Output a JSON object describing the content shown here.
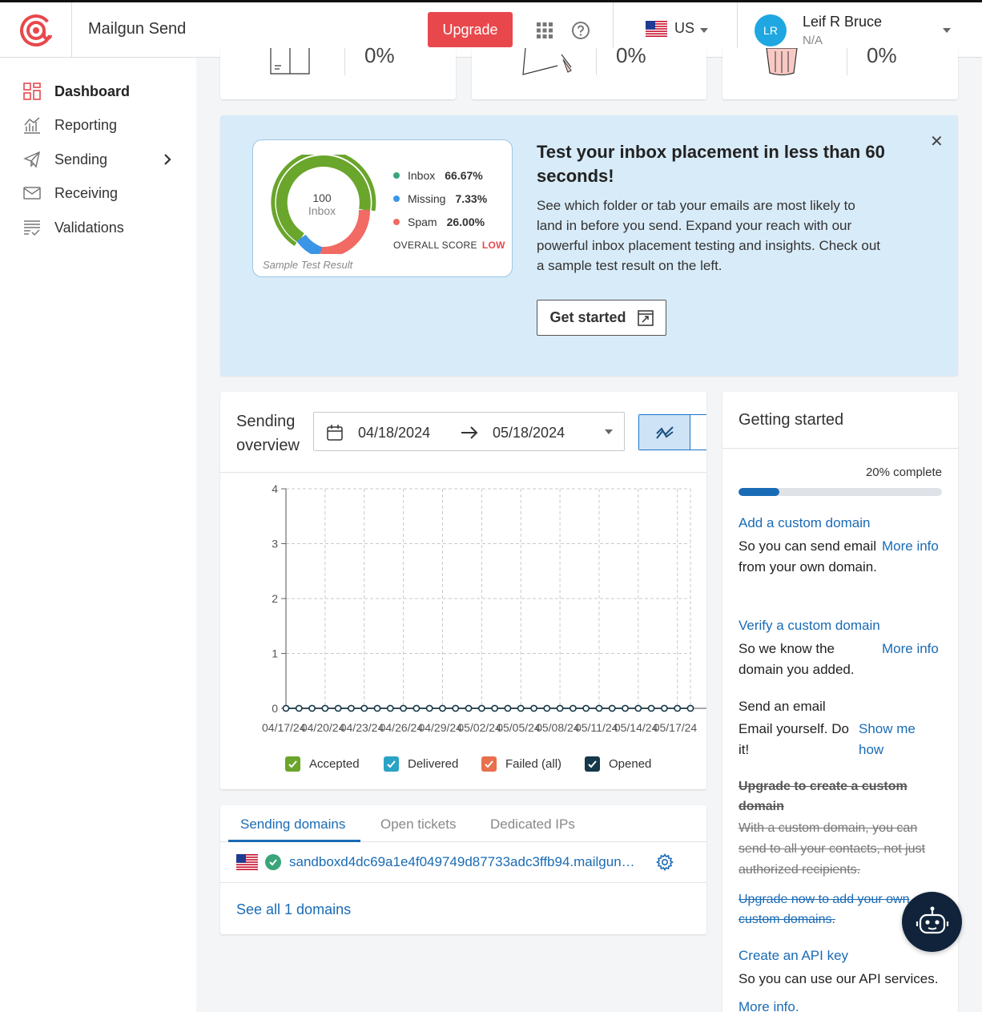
{
  "header": {
    "app_name": "Mailgun Send",
    "upgrade_label": "Upgrade",
    "region": "US",
    "user": {
      "initials": "LR",
      "name": "Leif R Bruce",
      "subtitle": "N/A"
    }
  },
  "sidebar": {
    "items": [
      {
        "label": "Dashboard",
        "icon": "dashboard-icon",
        "active": true
      },
      {
        "label": "Reporting",
        "icon": "reporting-icon"
      },
      {
        "label": "Sending",
        "icon": "sending-icon",
        "has_submenu": true
      },
      {
        "label": "Receiving",
        "icon": "envelope-icon"
      },
      {
        "label": "Validations",
        "icon": "validations-icon"
      }
    ]
  },
  "stats_cards": [
    {
      "value": "0%",
      "icon": "inbox-icon"
    },
    {
      "value": "0%",
      "icon": "bounce-icon"
    },
    {
      "value": "0%",
      "icon": "trash-icon"
    }
  ],
  "banner": {
    "sample": {
      "score": "100",
      "score_label": "Inbox",
      "legend": [
        {
          "label": "Inbox",
          "value": "66.67%",
          "color": "#3aa57a"
        },
        {
          "label": "Missing",
          "value": "7.33%",
          "color": "#3b95e6"
        },
        {
          "label": "Spam",
          "value": "26.00%",
          "color": "#f16a63"
        }
      ],
      "overall_label": "OVERALL SCORE",
      "overall_value": "LOW",
      "caption": "Sample Test Result"
    },
    "title": "Test your inbox placement in less than 60 seconds!",
    "text": "See which folder or tab your emails are most likely to land in before you send. Expand your reach with our powerful inbox placement testing and insights. Check out a sample test result on the left.",
    "button_label": "Get started"
  },
  "overview": {
    "title": "Sending overview",
    "date_from": "04/18/2024",
    "date_to": "05/18/2024",
    "legend": [
      {
        "label": "Accepted",
        "color": "#6aa52c"
      },
      {
        "label": "Delivered",
        "color": "#2aa3c6"
      },
      {
        "label": "Failed (all)",
        "color": "#e8704a"
      },
      {
        "label": "Opened",
        "color": "#15384a"
      }
    ]
  },
  "chart_data": {
    "type": "line",
    "x": [
      "04/17/24",
      "04/18/24",
      "04/19/24",
      "04/20/24",
      "04/21/24",
      "04/22/24",
      "04/23/24",
      "04/24/24",
      "04/25/24",
      "04/26/24",
      "04/27/24",
      "04/28/24",
      "04/29/24",
      "04/30/24",
      "05/01/24",
      "05/02/24",
      "05/03/24",
      "05/04/24",
      "05/05/24",
      "05/06/24",
      "05/07/24",
      "05/08/24",
      "05/09/24",
      "05/10/24",
      "05/11/24",
      "05/12/24",
      "05/13/24",
      "05/14/24",
      "05/15/24",
      "05/16/24",
      "05/17/24",
      "05/18/24"
    ],
    "x_tick_labels": [
      "04/17/24",
      "04/20/24",
      "04/23/24",
      "04/26/24",
      "04/29/24",
      "05/02/24",
      "05/05/24",
      "05/08/24",
      "05/11/24",
      "05/14/24",
      "05/17/24"
    ],
    "y_ticks": [
      0,
      1,
      2,
      3,
      4
    ],
    "ylim": [
      0,
      4
    ],
    "grid": true,
    "series": [
      {
        "name": "Accepted",
        "values": [
          0,
          0,
          0,
          0,
          0,
          0,
          0,
          0,
          0,
          0,
          0,
          0,
          0,
          0,
          0,
          0,
          0,
          0,
          0,
          0,
          0,
          0,
          0,
          0,
          0,
          0,
          0,
          0,
          0,
          0,
          0,
          0
        ]
      },
      {
        "name": "Delivered",
        "values": [
          0,
          0,
          0,
          0,
          0,
          0,
          0,
          0,
          0,
          0,
          0,
          0,
          0,
          0,
          0,
          0,
          0,
          0,
          0,
          0,
          0,
          0,
          0,
          0,
          0,
          0,
          0,
          0,
          0,
          0,
          0,
          0
        ]
      },
      {
        "name": "Failed (all)",
        "values": [
          0,
          0,
          0,
          0,
          0,
          0,
          0,
          0,
          0,
          0,
          0,
          0,
          0,
          0,
          0,
          0,
          0,
          0,
          0,
          0,
          0,
          0,
          0,
          0,
          0,
          0,
          0,
          0,
          0,
          0,
          0,
          0
        ]
      },
      {
        "name": "Opened",
        "values": [
          0,
          0,
          0,
          0,
          0,
          0,
          0,
          0,
          0,
          0,
          0,
          0,
          0,
          0,
          0,
          0,
          0,
          0,
          0,
          0,
          0,
          0,
          0,
          0,
          0,
          0,
          0,
          0,
          0,
          0,
          0,
          0
        ]
      }
    ]
  },
  "domains": {
    "tabs": [
      "Sending domains",
      "Open tickets",
      "Dedicated IPs"
    ],
    "domain": "sandboxd4dc69a1e4f049749d87733adc3ffb94.mailgun…",
    "see_all": "See all 1 domains"
  },
  "getting_started": {
    "title": "Getting started",
    "progress_label": "20% complete",
    "progress": 0.2,
    "add_domain": {
      "title": "Add a custom domain",
      "text": "So you can send email from your own domain.",
      "more": "More info"
    },
    "verify_domain": {
      "title": "Verify a custom domain",
      "text": "So we know the domain you added.",
      "more": "More info"
    },
    "send_email": {
      "title": "Send an email",
      "text": "Email yourself. Do it!",
      "more": "Show me how"
    },
    "upgrade": {
      "title": "Upgrade to create a custom domain",
      "text": "With a custom domain, you can send to all your contacts, not just authorized recipients.",
      "link": "Upgrade now to add your own custom domains."
    },
    "api_key": {
      "title": "Create an API key",
      "text": "So you can use our API services.",
      "more": "More info."
    }
  },
  "chatbot": {
    "icon": "chatbot-icon"
  }
}
